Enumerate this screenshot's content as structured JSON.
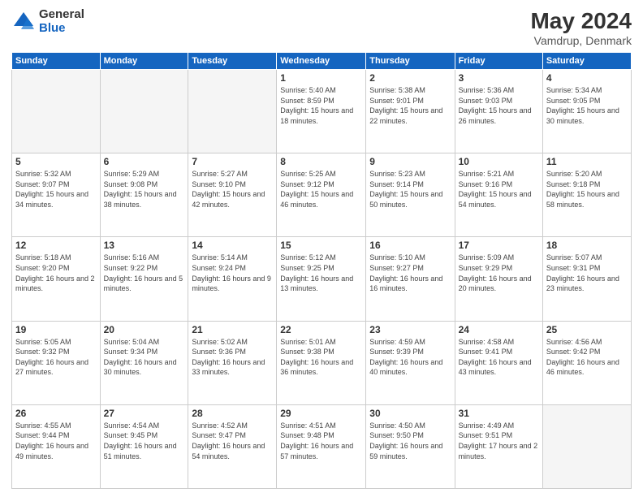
{
  "logo": {
    "general": "General",
    "blue": "Blue"
  },
  "header": {
    "title": "May 2024",
    "subtitle": "Vamdrup, Denmark"
  },
  "days_of_week": [
    "Sunday",
    "Monday",
    "Tuesday",
    "Wednesday",
    "Thursday",
    "Friday",
    "Saturday"
  ],
  "weeks": [
    [
      {
        "day": "",
        "info": ""
      },
      {
        "day": "",
        "info": ""
      },
      {
        "day": "",
        "info": ""
      },
      {
        "day": "1",
        "info": "Sunrise: 5:40 AM\nSunset: 8:59 PM\nDaylight: 15 hours\nand 18 minutes."
      },
      {
        "day": "2",
        "info": "Sunrise: 5:38 AM\nSunset: 9:01 PM\nDaylight: 15 hours\nand 22 minutes."
      },
      {
        "day": "3",
        "info": "Sunrise: 5:36 AM\nSunset: 9:03 PM\nDaylight: 15 hours\nand 26 minutes."
      },
      {
        "day": "4",
        "info": "Sunrise: 5:34 AM\nSunset: 9:05 PM\nDaylight: 15 hours\nand 30 minutes."
      }
    ],
    [
      {
        "day": "5",
        "info": "Sunrise: 5:32 AM\nSunset: 9:07 PM\nDaylight: 15 hours\nand 34 minutes."
      },
      {
        "day": "6",
        "info": "Sunrise: 5:29 AM\nSunset: 9:08 PM\nDaylight: 15 hours\nand 38 minutes."
      },
      {
        "day": "7",
        "info": "Sunrise: 5:27 AM\nSunset: 9:10 PM\nDaylight: 15 hours\nand 42 minutes."
      },
      {
        "day": "8",
        "info": "Sunrise: 5:25 AM\nSunset: 9:12 PM\nDaylight: 15 hours\nand 46 minutes."
      },
      {
        "day": "9",
        "info": "Sunrise: 5:23 AM\nSunset: 9:14 PM\nDaylight: 15 hours\nand 50 minutes."
      },
      {
        "day": "10",
        "info": "Sunrise: 5:21 AM\nSunset: 9:16 PM\nDaylight: 15 hours\nand 54 minutes."
      },
      {
        "day": "11",
        "info": "Sunrise: 5:20 AM\nSunset: 9:18 PM\nDaylight: 15 hours\nand 58 minutes."
      }
    ],
    [
      {
        "day": "12",
        "info": "Sunrise: 5:18 AM\nSunset: 9:20 PM\nDaylight: 16 hours\nand 2 minutes."
      },
      {
        "day": "13",
        "info": "Sunrise: 5:16 AM\nSunset: 9:22 PM\nDaylight: 16 hours\nand 5 minutes."
      },
      {
        "day": "14",
        "info": "Sunrise: 5:14 AM\nSunset: 9:24 PM\nDaylight: 16 hours\nand 9 minutes."
      },
      {
        "day": "15",
        "info": "Sunrise: 5:12 AM\nSunset: 9:25 PM\nDaylight: 16 hours\nand 13 minutes."
      },
      {
        "day": "16",
        "info": "Sunrise: 5:10 AM\nSunset: 9:27 PM\nDaylight: 16 hours\nand 16 minutes."
      },
      {
        "day": "17",
        "info": "Sunrise: 5:09 AM\nSunset: 9:29 PM\nDaylight: 16 hours\nand 20 minutes."
      },
      {
        "day": "18",
        "info": "Sunrise: 5:07 AM\nSunset: 9:31 PM\nDaylight: 16 hours\nand 23 minutes."
      }
    ],
    [
      {
        "day": "19",
        "info": "Sunrise: 5:05 AM\nSunset: 9:32 PM\nDaylight: 16 hours\nand 27 minutes."
      },
      {
        "day": "20",
        "info": "Sunrise: 5:04 AM\nSunset: 9:34 PM\nDaylight: 16 hours\nand 30 minutes."
      },
      {
        "day": "21",
        "info": "Sunrise: 5:02 AM\nSunset: 9:36 PM\nDaylight: 16 hours\nand 33 minutes."
      },
      {
        "day": "22",
        "info": "Sunrise: 5:01 AM\nSunset: 9:38 PM\nDaylight: 16 hours\nand 36 minutes."
      },
      {
        "day": "23",
        "info": "Sunrise: 4:59 AM\nSunset: 9:39 PM\nDaylight: 16 hours\nand 40 minutes."
      },
      {
        "day": "24",
        "info": "Sunrise: 4:58 AM\nSunset: 9:41 PM\nDaylight: 16 hours\nand 43 minutes."
      },
      {
        "day": "25",
        "info": "Sunrise: 4:56 AM\nSunset: 9:42 PM\nDaylight: 16 hours\nand 46 minutes."
      }
    ],
    [
      {
        "day": "26",
        "info": "Sunrise: 4:55 AM\nSunset: 9:44 PM\nDaylight: 16 hours\nand 49 minutes."
      },
      {
        "day": "27",
        "info": "Sunrise: 4:54 AM\nSunset: 9:45 PM\nDaylight: 16 hours\nand 51 minutes."
      },
      {
        "day": "28",
        "info": "Sunrise: 4:52 AM\nSunset: 9:47 PM\nDaylight: 16 hours\nand 54 minutes."
      },
      {
        "day": "29",
        "info": "Sunrise: 4:51 AM\nSunset: 9:48 PM\nDaylight: 16 hours\nand 57 minutes."
      },
      {
        "day": "30",
        "info": "Sunrise: 4:50 AM\nSunset: 9:50 PM\nDaylight: 16 hours\nand 59 minutes."
      },
      {
        "day": "31",
        "info": "Sunrise: 4:49 AM\nSunset: 9:51 PM\nDaylight: 17 hours\nand 2 minutes."
      },
      {
        "day": "",
        "info": ""
      }
    ]
  ]
}
